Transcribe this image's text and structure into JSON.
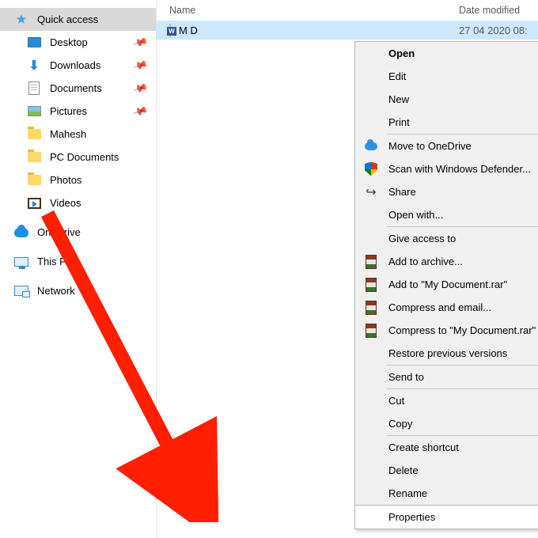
{
  "columns": {
    "name": "Name",
    "date": "Date modified"
  },
  "nav": {
    "quick_access": "Quick access",
    "desktop": "Desktop",
    "downloads": "Downloads",
    "documents": "Documents",
    "pictures": "Pictures",
    "mahesh": "Mahesh",
    "pc_documents": "PC Documents",
    "photos": "Photos",
    "videos": "Videos",
    "onedrive": "OneDrive",
    "this_pc": "This PC",
    "network": "Network"
  },
  "file": {
    "name_partial": "M   D",
    "date_partial": "27 04 2020  08:"
  },
  "ctx": {
    "open": "Open",
    "edit": "Edit",
    "new": "New",
    "print": "Print",
    "move_onedrive": "Move to OneDrive",
    "scan_defender": "Scan with Windows Defender...",
    "share": "Share",
    "open_with": "Open with...",
    "give_access": "Give access to",
    "add_archive": "Add to archive...",
    "add_rar": "Add to \"My Document.rar\"",
    "compress_email": "Compress and email...",
    "compress_rar_email": "Compress to \"My Document.rar\" and email",
    "restore": "Restore previous versions",
    "send_to": "Send to",
    "cut": "Cut",
    "copy": "Copy",
    "create_shortcut": "Create shortcut",
    "delete": "Delete",
    "rename": "Rename",
    "properties": "Properties"
  }
}
